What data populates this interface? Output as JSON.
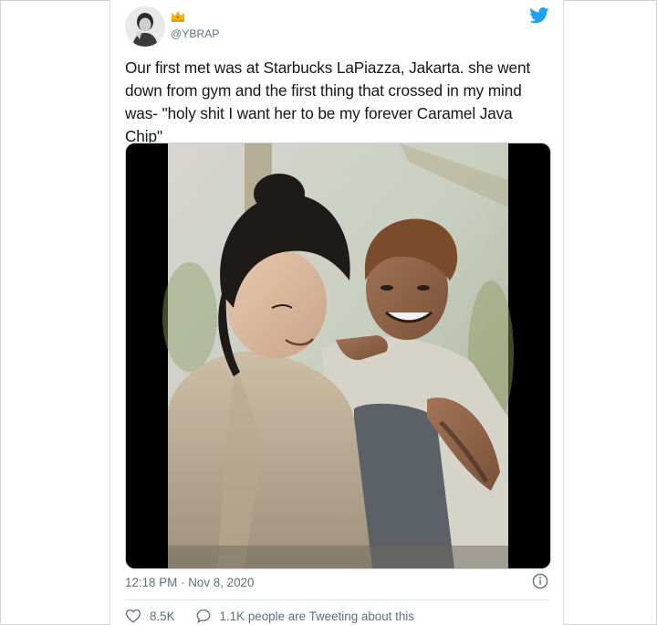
{
  "tweet": {
    "handle": "@YBRAP",
    "text": "Our first met was at Starbucks LaPiazza, Jakarta. she went down from gym and the first thing that crossed in my mind was- \"holy shit I want her to be my forever Caramel Java Chip\"",
    "timestamp": "12:18 PM · Nov 8, 2020",
    "likes": "8.5K",
    "conversation": "1.1K people are Tweeting about this"
  },
  "icons": {
    "brand": "twitter-bird-icon",
    "badge": "crown-icon",
    "like": "heart-icon",
    "reply": "speech-bubble-icon",
    "info": "info-icon"
  },
  "colors": {
    "twitter_blue": "#1da1f2",
    "secondary_text": "#5b7083",
    "primary_text": "#14171a"
  }
}
